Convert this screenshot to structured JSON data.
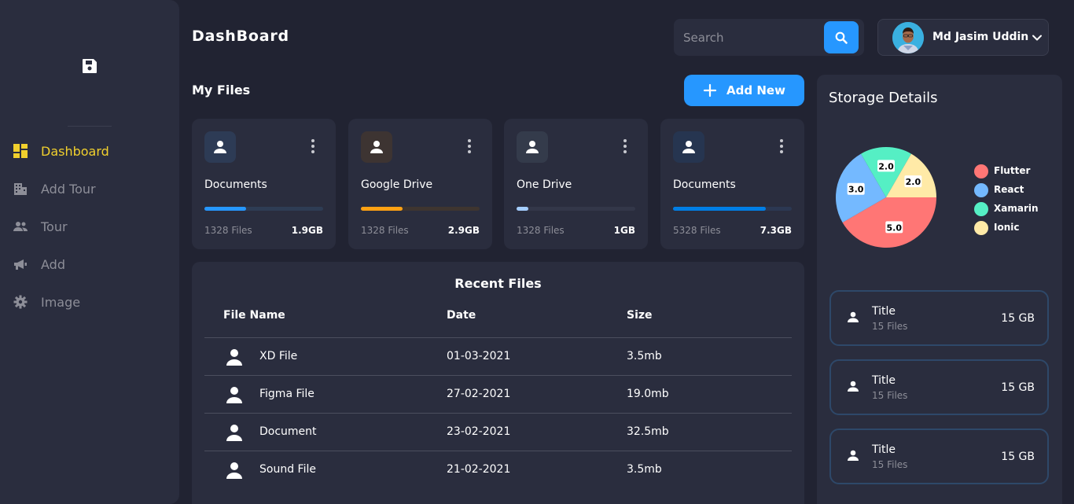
{
  "sidebar": {
    "logo_icon": "save-floppy-icon",
    "items": [
      {
        "label": "Dashboard",
        "icon": "dashboard-icon",
        "active": true
      },
      {
        "label": "Add Tour",
        "icon": "building-icon",
        "active": false
      },
      {
        "label": "Tour",
        "icon": "people-icon",
        "active": false
      },
      {
        "label": "Add",
        "icon": "megaphone-icon",
        "active": false
      },
      {
        "label": "Image",
        "icon": "gear-icon",
        "active": false
      }
    ]
  },
  "header": {
    "title": "DashBoard",
    "search_placeholder": "Search",
    "profile_name": "Md Jasim Uddin"
  },
  "my_files": {
    "title": "My Files",
    "add_label": "Add New",
    "cards": [
      {
        "name": "Documents",
        "files": "1328 Files",
        "size": "1.9GB",
        "progress": 0.35,
        "color": "#2697ff"
      },
      {
        "name": "Google Drive",
        "files": "1328 Files",
        "size": "2.9GB",
        "progress": 0.35,
        "color": "#ffa113"
      },
      {
        "name": "One Drive",
        "files": "1328 Files",
        "size": "1GB",
        "progress": 0.1,
        "color": "#a4cdff"
      },
      {
        "name": "Documents",
        "files": "5328 Files",
        "size": "7.3GB",
        "progress": 0.78,
        "color": "#007ee5"
      }
    ]
  },
  "recent_files": {
    "title": "Recent Files",
    "columns": [
      "File Name",
      "Date",
      "Size"
    ],
    "rows": [
      {
        "name": "XD File",
        "date": "01-03-2021",
        "size": "3.5mb"
      },
      {
        "name": "Figma File",
        "date": "27-02-2021",
        "size": "19.0mb"
      },
      {
        "name": "Document",
        "date": "23-02-2021",
        "size": "32.5mb"
      },
      {
        "name": "Sound File",
        "date": "21-02-2021",
        "size": "3.5mb"
      }
    ]
  },
  "storage": {
    "title": "Storage Details",
    "legend": [
      {
        "label": "Flutter",
        "color": "#ff7675"
      },
      {
        "label": "React",
        "color": "#74b9ff"
      },
      {
        "label": "Xamarin",
        "color": "#55efc4"
      },
      {
        "label": "Ionic",
        "color": "#ffeaa7"
      }
    ],
    "items": [
      {
        "title": "Title",
        "files": "15 Files",
        "size": "15 GB"
      },
      {
        "title": "Title",
        "files": "15 Files",
        "size": "15 GB"
      },
      {
        "title": "Title",
        "files": "15 Files",
        "size": "15 GB"
      }
    ]
  },
  "chart_data": {
    "type": "pie",
    "categories": [
      "Flutter",
      "React",
      "Xamarin",
      "Ionic"
    ],
    "values": [
      5.0,
      3.0,
      2.0,
      2.0
    ],
    "colors": [
      "#ff7675",
      "#74b9ff",
      "#55efc4",
      "#ffeaa7"
    ]
  }
}
